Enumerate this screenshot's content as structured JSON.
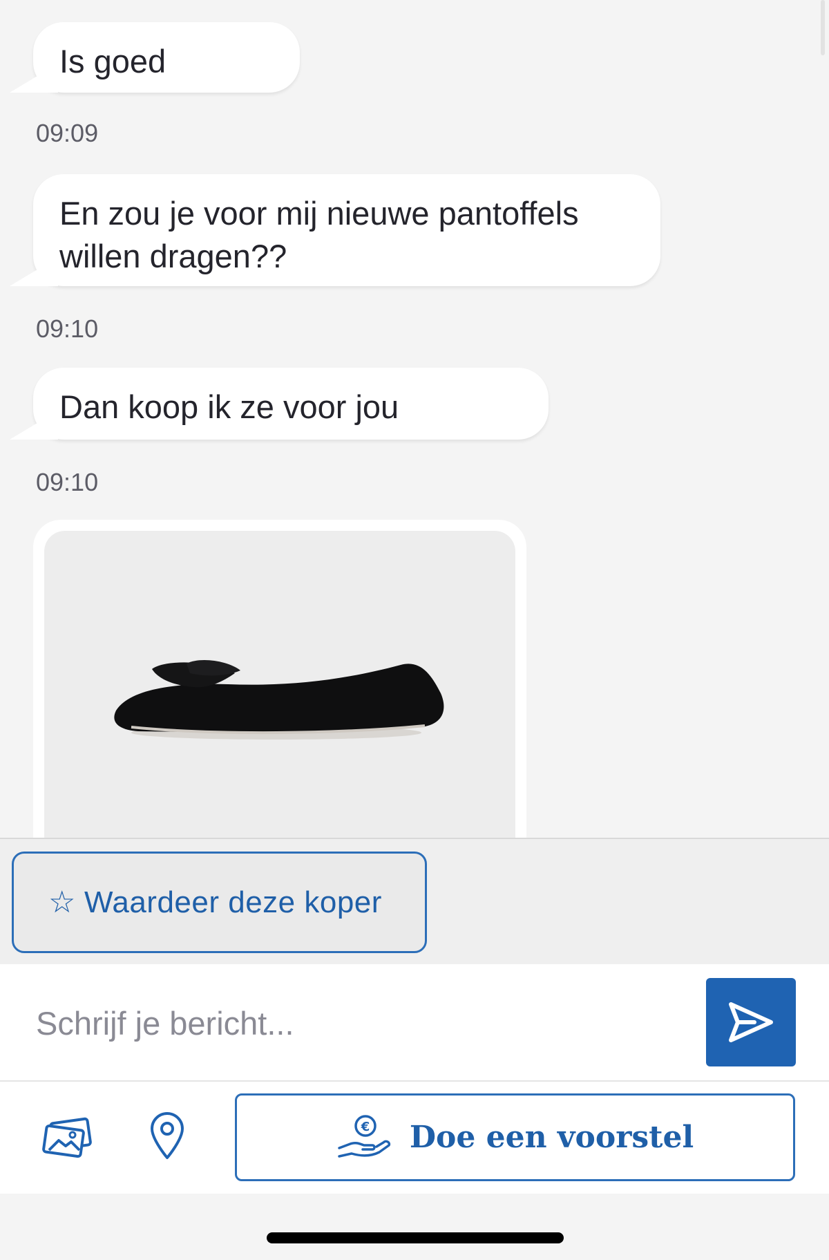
{
  "messages": [
    {
      "text": "Is goed",
      "time": "09:09"
    },
    {
      "text": "En zou je voor mij nieuwe pantoffels willen dragen??",
      "time": "09:10"
    },
    {
      "text": "Dan koop ik ze voor jou",
      "time": "09:10"
    }
  ],
  "image_message": {
    "icon": "slipper-photo"
  },
  "actions": {
    "rate_buyer_label": "Waardeer deze koper",
    "rate_icon": "star-outline-icon"
  },
  "composer": {
    "placeholder": "Schrijf je bericht...",
    "send_icon": "send-icon"
  },
  "bottom_bar": {
    "photo_icon": "photo-gallery-icon",
    "location_icon": "location-pin-icon",
    "offer_label": "Doe een voorstel",
    "offer_icon": "hand-euro-icon"
  },
  "colors": {
    "accent": "#1f63b2",
    "background": "#f4f4f4",
    "bubble": "#ffffff"
  }
}
